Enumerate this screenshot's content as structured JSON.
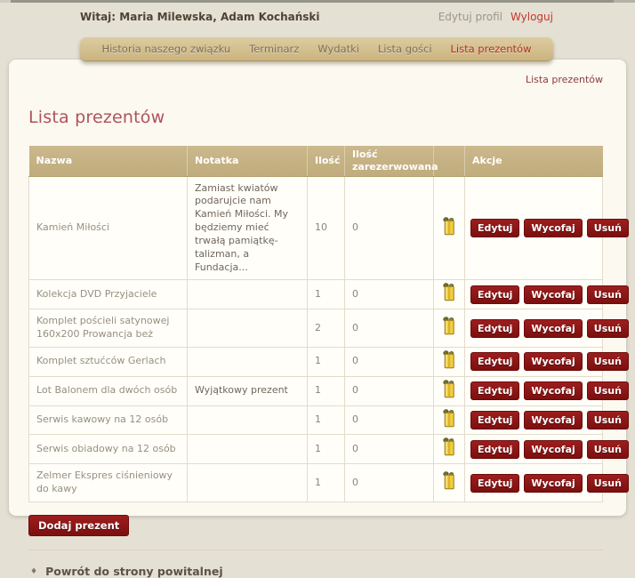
{
  "header": {
    "welcome": "Witaj: Maria Milewska, Adam Kochański",
    "edit_profile": "Edytuj profil",
    "logout": "Wyloguj"
  },
  "nav": {
    "tabs": [
      {
        "key": "historia-naszego-zwiazku",
        "label": "Historia naszego związku",
        "active": false
      },
      {
        "key": "terminarz",
        "label": "Terminarz",
        "active": false
      },
      {
        "key": "wydatki",
        "label": "Wydatki",
        "active": false
      },
      {
        "key": "lista-gosci",
        "label": "Lista gości",
        "active": false
      },
      {
        "key": "lista-prezentow",
        "label": "Lista prezentów",
        "active": true
      }
    ]
  },
  "breadcrumb": "Lista prezentów",
  "page_title": "Lista prezentów",
  "table": {
    "columns": {
      "name": "Nazwa",
      "note": "Notatka",
      "qty": "Ilość",
      "reserved": "Ilość zarezerwowana",
      "icon": "",
      "actions": "Akcje"
    },
    "action_labels": {
      "edit": "Edytuj",
      "withdraw": "Wycofaj",
      "delete": "Usuń"
    },
    "rows": [
      {
        "name": "Kamień Miłości",
        "note": "Zamiast kwiatów podarujcie nam Kamień Miłości. My będziemy mieć trwałą pamiątkę-talizman, a Fundacja...",
        "qty": "10",
        "reserved": "0"
      },
      {
        "name": "Kolekcja DVD Przyjaciele",
        "note": "",
        "qty": "1",
        "reserved": "0"
      },
      {
        "name": "Komplet pościeli satynowej 160x200 Prowancja beż",
        "note": "",
        "qty": "2",
        "reserved": "0"
      },
      {
        "name": "Komplet sztućców Gerlach",
        "note": "",
        "qty": "1",
        "reserved": "0"
      },
      {
        "name": "Lot Balonem dla dwóch osób",
        "note": "Wyjątkowy prezent",
        "qty": "1",
        "reserved": "0"
      },
      {
        "name": "Serwis kawowy na 12 osób",
        "note": "",
        "qty": "1",
        "reserved": "0"
      },
      {
        "name": "Serwis obiadowy na 12 osób",
        "note": "",
        "qty": "1",
        "reserved": "0"
      },
      {
        "name": "Zelmer Ekspres ciśnieniowy do kawy",
        "note": "",
        "qty": "1",
        "reserved": "0"
      }
    ]
  },
  "footer": {
    "add_button": "Dodaj prezent",
    "bullet": "♦",
    "back_link": "Powrót do strony powitalnej"
  },
  "colors": {
    "accent_red": "#8c1414",
    "tab_active_red": "#b1301f",
    "header_tan": "#c4b183",
    "title_rose": "#ae535a",
    "panel_bg": "#fcf9f1",
    "page_bg": "#e4e0d4",
    "gift_gold": "#f0ce3e"
  }
}
